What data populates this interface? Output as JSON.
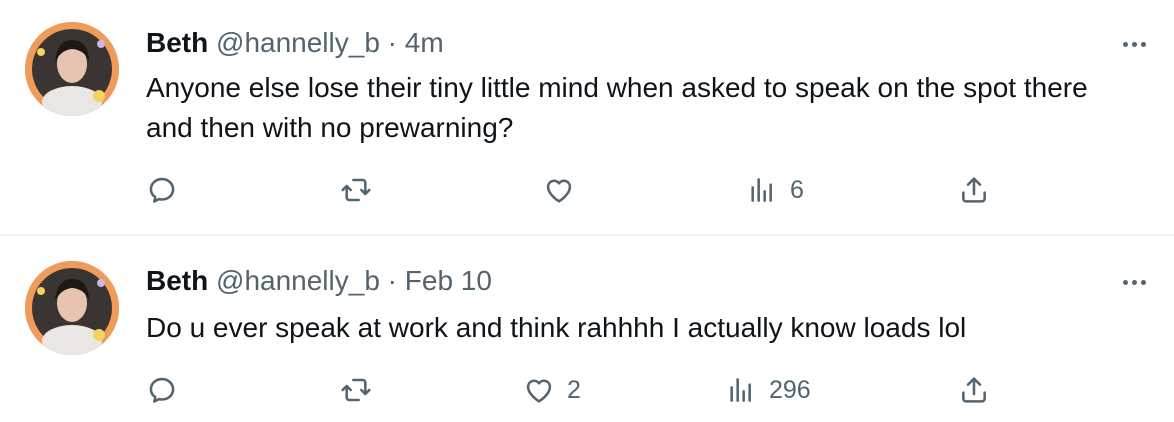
{
  "tweets": [
    {
      "author_name": "Beth",
      "handle": "@hannelly_b",
      "separator": "·",
      "time": "4m",
      "text": "Anyone else lose their tiny little mind when asked to speak on the spot there and then with no prewarning?",
      "actions": {
        "reply_icon": "reply-icon",
        "retweet_icon": "retweet-icon",
        "like_icon": "heart-icon",
        "like_count": "",
        "views_icon": "views-icon",
        "views_count": "6",
        "share_icon": "share-icon"
      }
    },
    {
      "author_name": "Beth",
      "handle": "@hannelly_b",
      "separator": "·",
      "time": "Feb 10",
      "text": "Do u ever speak at work and think rahhhh I actually know loads lol",
      "actions": {
        "reply_icon": "reply-icon",
        "retweet_icon": "retweet-icon",
        "like_icon": "heart-icon",
        "like_count": "2",
        "views_icon": "views-icon",
        "views_count": "296",
        "share_icon": "share-icon"
      }
    }
  ],
  "colors": {
    "text_primary": "#0f1419",
    "text_secondary": "#536471",
    "avatar_ring": "#ef9b5b",
    "divider": "#eff3f4"
  }
}
